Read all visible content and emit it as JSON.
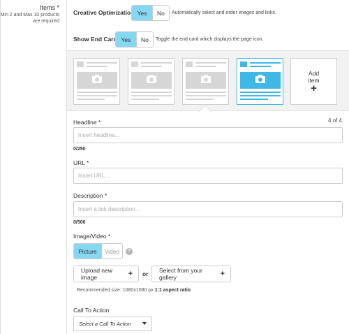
{
  "items": {
    "title": "Items *",
    "subtitle": "Min 2 and Max 10 products are required"
  },
  "creative_optimization": {
    "label": "Creative Optimization",
    "yes": "Yes",
    "no": "No",
    "selected": "Yes",
    "hint": "Automatically select and order images and links."
  },
  "end_card": {
    "label": "Show End Card",
    "yes": "Yes",
    "no": "No",
    "selected": "Yes",
    "hint": "Toggle the end card which displays the page icon."
  },
  "carousel": {
    "cards": [
      "card-1",
      "card-2",
      "card-3",
      "card-4"
    ],
    "selected_index": 4,
    "add_item_line1": "Add",
    "add_item_line2": "item",
    "position": "4 of 4"
  },
  "form": {
    "headline": {
      "label": "Headline *",
      "placeholder": "Insert headline...",
      "value": "",
      "counter": "0/250"
    },
    "url": {
      "label": "URL *",
      "placeholder": "Insert URL...",
      "value": ""
    },
    "description": {
      "label": "Description *",
      "placeholder": "Insert a link description...",
      "value": "",
      "counter": "0/500"
    },
    "media": {
      "label": "Image/Video *",
      "picture": "Picture",
      "video": "Video",
      "selected": "Picture",
      "help": "?"
    },
    "upload_button": "Upload new image",
    "or": "or",
    "gallery_button": "Select from your gallery",
    "recommended_prefix": "Recommended size: 1080x1080 px",
    "recommended_ratio": "1:1 aspect ratio",
    "cta": {
      "label": "Call To Action",
      "placeholder": "Select a Call To Action"
    }
  },
  "colors": {
    "accent": "#86d8f2",
    "selected_card": "#3fb8e6"
  }
}
